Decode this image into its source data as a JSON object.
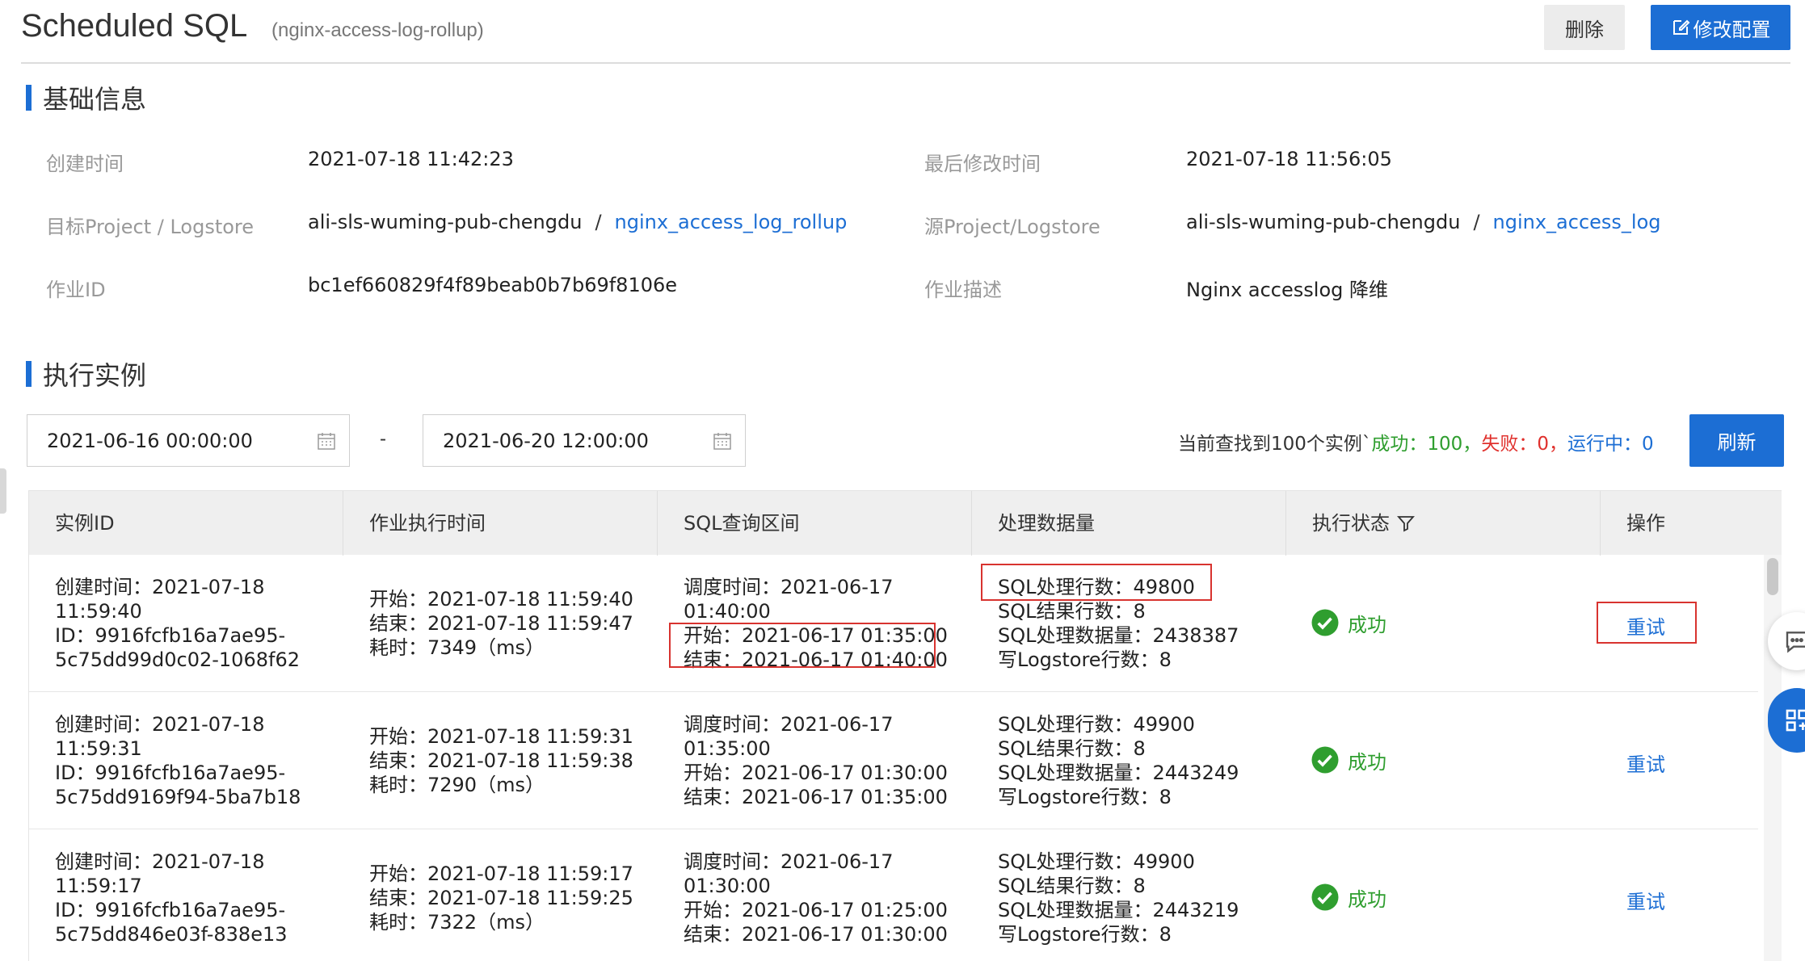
{
  "header": {
    "title": "Scheduled SQL",
    "subtitle": "(nginx-access-log-rollup)",
    "delete_label": "删除",
    "edit_label": "修改配置"
  },
  "basic": {
    "heading": "基础信息",
    "fields": {
      "created_label": "创建时间",
      "created_value": "2021-07-18 11:42:23",
      "modified_label": "最后修改时间",
      "modified_value": "2021-07-18 11:56:05",
      "target_label": "目标Project / Logstore",
      "target_project": "ali-sls-wuming-pub-chengdu",
      "target_logstore": "nginx_access_log_rollup",
      "source_label": "源Project/Logstore",
      "source_project": "ali-sls-wuming-pub-chengdu",
      "source_logstore": "nginx_access_log",
      "job_id_label": "作业ID",
      "job_id_value": "bc1ef660829f4f89beab0b7b69f8106e",
      "desc_label": "作业描述",
      "desc_value": "Nginx accesslog 降维",
      "separator": "/"
    }
  },
  "instances": {
    "heading": "执行实例",
    "start_date": "2021-06-16 00:00:00",
    "end_date": "2021-06-20 12:00:00",
    "range_dash": "-",
    "found_prefix": "当前查找到100个实例`",
    "success_text": "成功：100，",
    "fail_text": "失败：0，",
    "running_text": "运行中：0",
    "refresh_label": "刷新",
    "columns": [
      "实例ID",
      "作业执行时间",
      "SQL查询区间",
      "处理数据量",
      "执行状态",
      "操作"
    ],
    "rows": [
      {
        "id": [
          "创建时间：2021-07-18",
          "11:59:40",
          "ID：9916fcfb16a7ae95-",
          "5c75dd99d0c02-1068f62"
        ],
        "exec": [
          "开始：2021-07-18 11:59:40",
          "结束：2021-07-18 11:59:47",
          "耗时：7349（ms）"
        ],
        "query": [
          "调度时间：2021-06-17",
          "01:40:00",
          "开始：2021-06-17 01:35:00",
          "结束：2021-06-17 01:40:00"
        ],
        "data": [
          "SQL处理行数：49800",
          "SQL结果行数：8",
          "SQL处理数据量：2438387",
          "写Logstore行数：8"
        ],
        "status": "成功",
        "action": "重试"
      },
      {
        "id": [
          "创建时间：2021-07-18",
          "11:59:31",
          "ID：9916fcfb16a7ae95-",
          "5c75dd9169f94-5ba7b18"
        ],
        "exec": [
          "开始：2021-07-18 11:59:31",
          "结束：2021-07-18 11:59:38",
          "耗时：7290（ms）"
        ],
        "query": [
          "调度时间：2021-06-17",
          "01:35:00",
          "开始：2021-06-17 01:30:00",
          "结束：2021-06-17 01:35:00"
        ],
        "data": [
          "SQL处理行数：49900",
          "SQL结果行数：8",
          "SQL处理数据量：2443249",
          "写Logstore行数：8"
        ],
        "status": "成功",
        "action": "重试"
      },
      {
        "id": [
          "创建时间：2021-07-18",
          "11:59:17",
          "ID：9916fcfb16a7ae95-",
          "5c75dd846e03f-838e13"
        ],
        "exec": [
          "开始：2021-07-18 11:59:17",
          "结束：2021-07-18 11:59:25",
          "耗时：7322（ms）"
        ],
        "query": [
          "调度时间：2021-06-17",
          "01:30:00",
          "开始：2021-06-17 01:25:00",
          "结束：2021-06-17 01:30:00"
        ],
        "data": [
          "SQL处理行数：49900",
          "SQL结果行数：8",
          "SQL处理数据量：2443219",
          "写Logstore行数：8"
        ],
        "status": "成功",
        "action": "重试"
      }
    ]
  },
  "colors": {
    "accent": "#1c6ed4",
    "success": "#2f9e2f",
    "fail": "#e0302c",
    "highlight_box": "#d8332f"
  },
  "icons": {
    "edit": "edit-icon",
    "calendar": "calendar-icon",
    "filter": "filter-icon",
    "status": "check-circle-icon",
    "chat": "chat-icon",
    "apps": "apps-icon"
  }
}
